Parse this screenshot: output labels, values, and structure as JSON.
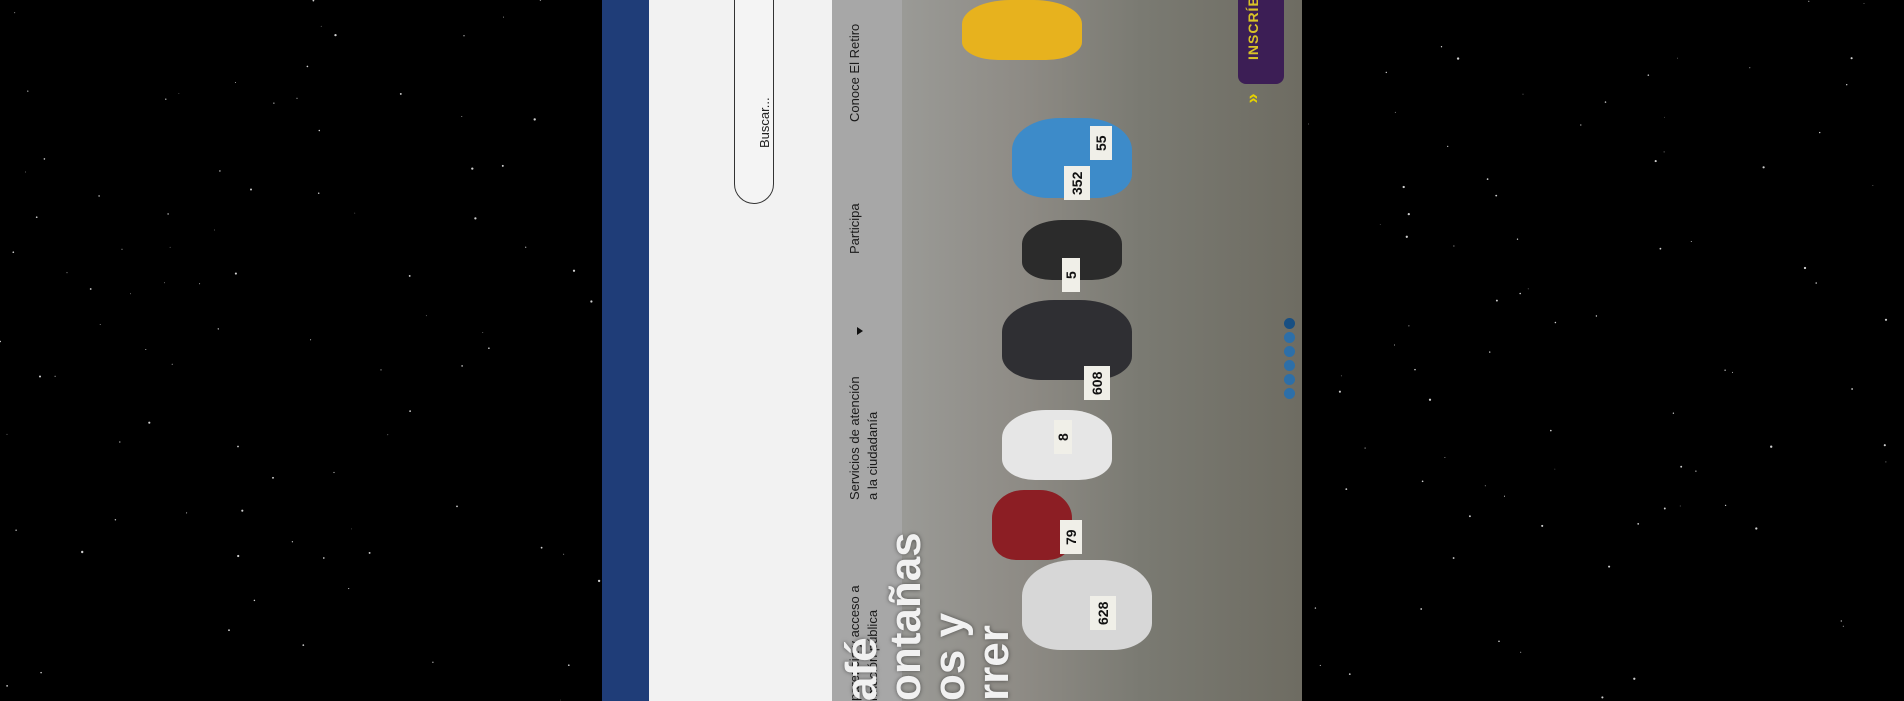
{
  "header": {
    "search_placeholder": "Buscar..."
  },
  "nav": {
    "items": [
      {
        "label_lines": [
          "Conoce El Retiro"
        ]
      },
      {
        "label_lines": [
          "Participa"
        ]
      },
      {
        "label_lines": [
          "Servicios de atención",
          "a la ciudadanía"
        ]
      },
      {
        "label_lines": [
          "parencia y acceso a",
          "rmación pública"
        ]
      }
    ]
  },
  "hero": {
    "title_lines": [
      "afé",
      "ontañas",
      "os y",
      "rrer"
    ],
    "bibs": [
      "352",
      "608",
      "628",
      "5",
      "8",
      "55",
      "79"
    ],
    "cta_label": "INSCRÍBE",
    "cta_arrow": "»",
    "carousel_dot_count": 6,
    "carousel_active_index": 0
  },
  "colors": {
    "brand_blue": "#1f3d78",
    "cta_purple": "#3c1e55",
    "cta_yellow": "#d9c227"
  }
}
